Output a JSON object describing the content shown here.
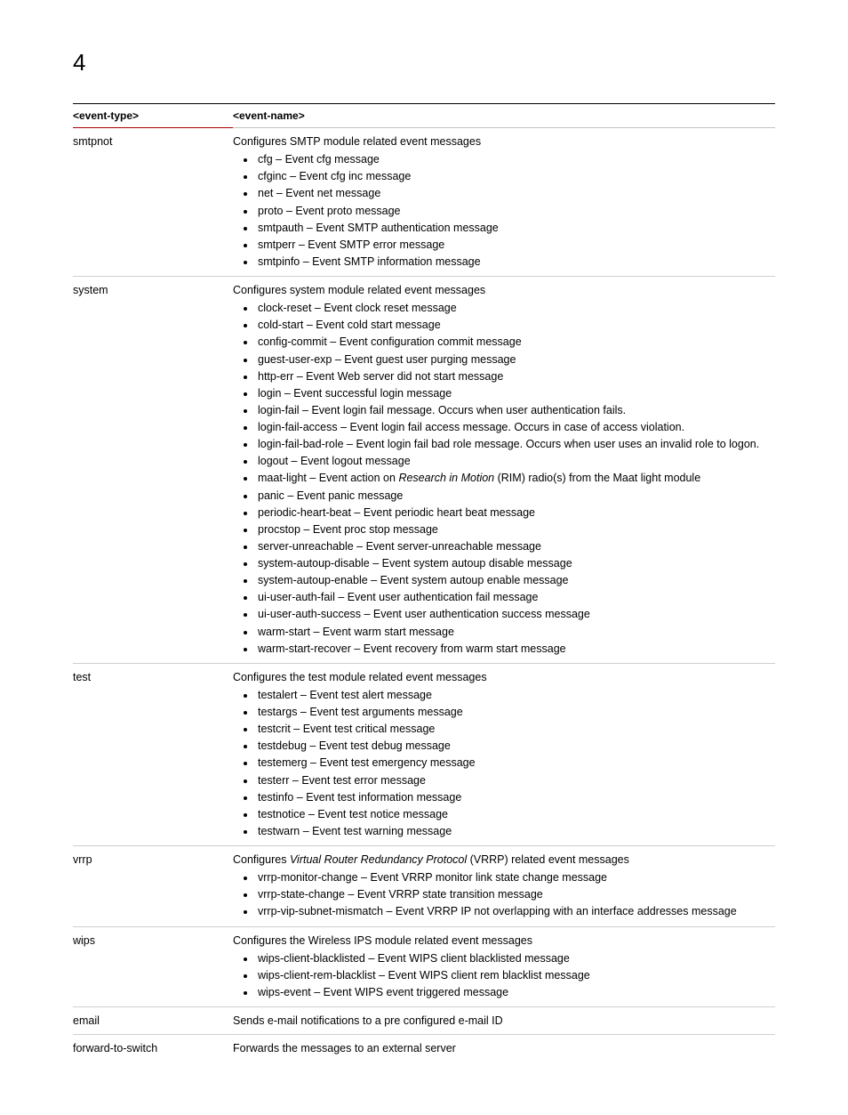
{
  "page_number": "4",
  "headers": {
    "col1": "<event-type>",
    "col2": "<event-name>"
  },
  "rows": [
    {
      "type": "smtpnot",
      "intro": "Configures SMTP module related event messages",
      "items": [
        "cfg – Event cfg message",
        "cfginc – Event cfg inc message",
        "net – Event net message",
        "proto – Event proto message",
        "smtpauth – Event SMTP authentication message",
        "smtperr – Event SMTP error message",
        "smtpinfo – Event SMTP information message"
      ]
    },
    {
      "type": "system",
      "intro": "Configures system module related event messages",
      "items": [
        "clock-reset – Event clock reset message",
        "cold-start – Event cold start message",
        "config-commit – Event configuration commit message",
        "guest-user-exp – Event guest user purging message",
        "http-err – Event Web server did not start message",
        "login – Event successful login message",
        "login-fail – Event login fail message. Occurs when user authentication fails.",
        "login-fail-access – Event login fail access message. Occurs in case of access violation.",
        "login-fail-bad-role – Event login fail bad role message. Occurs when user uses an invalid role to logon.",
        "logout – Event logout message",
        "maat-light – Event action on <em>Research in Motion</em> (RIM) radio(s) from the Maat light module",
        "panic – Event panic message",
        "periodic-heart-beat – Event periodic heart beat message",
        "procstop – Event proc stop message",
        "server-unreachable – Event server-unreachable message",
        "system-autoup-disable – Event system autoup disable message",
        "system-autoup-enable – Event system autoup enable message",
        "ui-user-auth-fail – Event user authentication fail message",
        "ui-user-auth-success – Event user authentication success message",
        "warm-start – Event warm start message",
        "warm-start-recover – Event recovery from warm start message"
      ]
    },
    {
      "type": "test",
      "intro": "Configures the test module related event messages",
      "items": [
        "testalert – Event test alert message",
        "testargs – Event test arguments message",
        "testcrit – Event test critical message",
        "testdebug – Event test debug message",
        "testemerg – Event test emergency message",
        "testerr – Event test error message",
        "testinfo – Event test information message",
        "testnotice – Event test notice message",
        "testwarn – Event test warning message"
      ]
    },
    {
      "type": "vrrp",
      "intro": "Configures <em>Virtual Router Redundancy Protocol</em> (VRRP) related event messages",
      "items": [
        "vrrp-monitor-change – Event VRRP monitor link state change message",
        "vrrp-state-change – Event VRRP state transition message",
        "vrrp-vip-subnet-mismatch – Event VRRP IP not overlapping with an interface addresses message"
      ]
    },
    {
      "type": "wips",
      "intro": "Configures the Wireless IPS module related event messages",
      "items": [
        "wips-client-blacklisted – Event WIPS client blacklisted message",
        "wips-client-rem-blacklist – Event WIPS client rem blacklist message",
        "wips-event – Event WIPS event triggered message"
      ]
    },
    {
      "type": "email",
      "intro": "Sends e-mail notifications to a pre configured e-mail ID",
      "items": []
    },
    {
      "type": "forward-to-switch",
      "intro": "Forwards the messages to an external server",
      "items": [],
      "no_border": true
    }
  ]
}
